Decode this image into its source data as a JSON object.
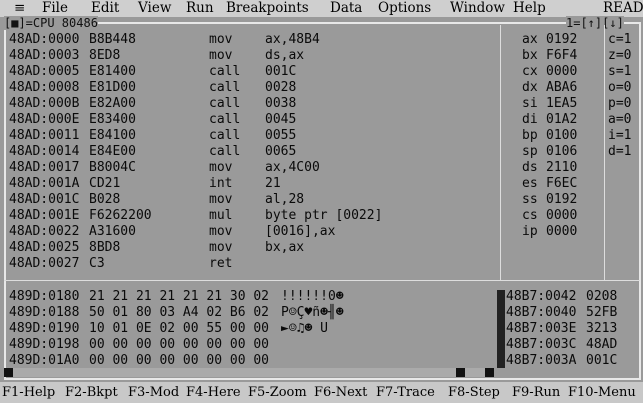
{
  "menubar": {
    "system_glyph": "≡",
    "items": [
      "File",
      "Edit",
      "View",
      "Run",
      "Breakpoints",
      "Data",
      "Options",
      "Window",
      "Help"
    ],
    "status": "READY"
  },
  "cpu_window": {
    "title_left": "[■]=CPU 80486",
    "title_right": "1=[↑][↓]",
    "code": [
      {
        "addr": "48AD:0000",
        "bytes": "B8B448",
        "op": "mov",
        "args": "ax,48B4"
      },
      {
        "addr": "48AD:0003",
        "bytes": "8ED8",
        "op": "mov",
        "args": "ds,ax"
      },
      {
        "addr": "48AD:0005",
        "bytes": "E81400",
        "op": "call",
        "args": "001C"
      },
      {
        "addr": "48AD:0008",
        "bytes": "E81D00",
        "op": "call",
        "args": "0028"
      },
      {
        "addr": "48AD:000B",
        "bytes": "E82A00",
        "op": "call",
        "args": "0038"
      },
      {
        "addr": "48AD:000E",
        "bytes": "E83400",
        "op": "call",
        "args": "0045"
      },
      {
        "addr": "48AD:0011",
        "bytes": "E84100",
        "op": "call",
        "args": "0055"
      },
      {
        "addr": "48AD:0014",
        "bytes": "E84E00",
        "op": "call",
        "args": "0065"
      },
      {
        "addr": "48AD:0017",
        "bytes": "B8004C",
        "op": "mov",
        "args": "ax,4C00"
      },
      {
        "addr": "48AD:001A",
        "bytes": "CD21",
        "op": "int",
        "args": "21"
      },
      {
        "addr": "48AD:001C",
        "bytes": "B028",
        "op": "mov",
        "args": "al,28"
      },
      {
        "addr": "48AD:001E",
        "bytes": "F6262200",
        "op": "mul",
        "args": "byte ptr [0022]"
      },
      {
        "addr": "48AD:0022",
        "bytes": "A31600",
        "op": "mov",
        "args": "[0016],ax"
      },
      {
        "addr": "48AD:0025",
        "bytes": "8BD8",
        "op": "mov",
        "args": "bx,ax"
      },
      {
        "addr": "48AD:0027",
        "bytes": "C3",
        "op": "ret",
        "args": ""
      }
    ],
    "registers": [
      {
        "name": "ax",
        "value": "0192"
      },
      {
        "name": "bx",
        "value": "F6F4"
      },
      {
        "name": "cx",
        "value": "0000"
      },
      {
        "name": "dx",
        "value": "ABA6"
      },
      {
        "name": "si",
        "value": "1EA5"
      },
      {
        "name": "di",
        "value": "01A2"
      },
      {
        "name": "bp",
        "value": "0100"
      },
      {
        "name": "sp",
        "value": "0106"
      },
      {
        "name": "ds",
        "value": "2110"
      },
      {
        "name": "es",
        "value": "F6EC"
      },
      {
        "name": "ss",
        "value": "0192"
      },
      {
        "name": "cs",
        "value": "0000"
      },
      {
        "name": "ip",
        "value": "0000"
      }
    ],
    "flags": [
      "c=1",
      "z=0",
      "s=1",
      "o=0",
      "p=0",
      "a=0",
      "i=1",
      "d=1"
    ],
    "dump": [
      {
        "addr": "489D:0180",
        "bytes": "21 21 21 21 21 21 30 02",
        "ascii": "!!!!!!0☻"
      },
      {
        "addr": "489D:0188",
        "bytes": "50 01 80 03 A4 02 B6 02",
        "ascii": "P☺Ç♥ñ☻╢☻"
      },
      {
        "addr": "489D:0190",
        "bytes": "10 01 0E 02 00 55 00 00",
        "ascii": "►☺♫☻ U"
      },
      {
        "addr": "489D:0198",
        "bytes": "00 00 00 00 00 00 00 00",
        "ascii": ""
      },
      {
        "addr": "489D:01A0",
        "bytes": "00 00 00 00 00 00 00 00",
        "ascii": ""
      }
    ],
    "stack": [
      {
        "addr": "48B7:0042",
        "value": "0208"
      },
      {
        "addr": "48B7:0040",
        "value": "52FB"
      },
      {
        "addr": "48B7:003E",
        "value": "3213"
      },
      {
        "addr": "48B7:003C",
        "value": "48AD"
      },
      {
        "addr": "48B7:003A",
        "value": "001C"
      }
    ]
  },
  "statusbar": [
    {
      "key": "F1",
      "label": "-Help"
    },
    {
      "key": "F2",
      "label": "-Bkpt"
    },
    {
      "key": "F3",
      "label": "-Mod"
    },
    {
      "key": "F4",
      "label": "-Here"
    },
    {
      "key": "F5",
      "label": "-Zoom"
    },
    {
      "key": "F6",
      "label": "-Next"
    },
    {
      "key": "F7",
      "label": "-Trace"
    },
    {
      "key": "F8",
      "label": "-Step"
    },
    {
      "key": "F9",
      "label": "-Run"
    },
    {
      "key": "F10",
      "label": "-Menu"
    }
  ]
}
